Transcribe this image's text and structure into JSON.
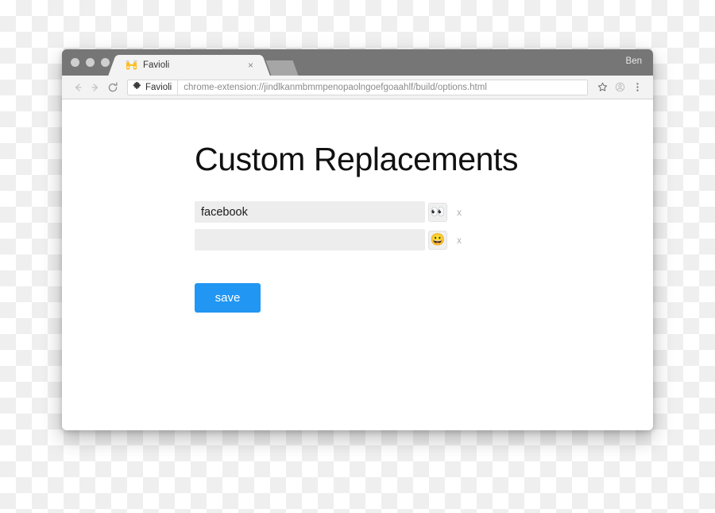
{
  "window": {
    "profile_name": "Ben",
    "traffic_lights": [
      "close",
      "minimize",
      "maximize"
    ]
  },
  "tab": {
    "title": "Favioli",
    "favicon": "favioli-binoculars-icon",
    "close_label": "×"
  },
  "toolbar": {
    "back_icon": "arrow-left-icon",
    "forward_icon": "arrow-right-icon",
    "reload_icon": "reload-icon",
    "extension_badge_label": "Favioli",
    "extension_badge_icon": "puzzle-piece-icon",
    "url": "chrome-extension://jindlkanmbmmpenopaolngoefgoaahlf/build/options.html",
    "bookmark_icon": "star-icon",
    "profile_icon": "profile-avatar-icon",
    "menu_icon": "three-dot-menu-icon"
  },
  "page": {
    "title": "Custom Replacements",
    "rows": [
      {
        "value": "facebook",
        "placeholder": "",
        "emoji": "👀",
        "emoji_name": "eyes-emoji",
        "remove_label": "x"
      },
      {
        "value": "",
        "placeholder": "",
        "emoji": "😀",
        "emoji_name": "grinning-face-emoji",
        "remove_label": "x"
      }
    ],
    "save_label": "save"
  },
  "colors": {
    "accent_blue": "#2196f3",
    "titlebar_gray": "#767676",
    "input_gray": "#ededed"
  }
}
